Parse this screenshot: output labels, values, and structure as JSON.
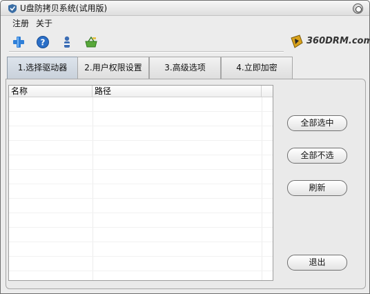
{
  "window": {
    "title": "U盘防拷贝系统(试用版)"
  },
  "menu": {
    "items": [
      "注册",
      "关于"
    ]
  },
  "toolbar": {
    "icons": [
      "add-icon",
      "help-icon",
      "user-icon",
      "basket-icon"
    ]
  },
  "logo": {
    "text": "360DRM.com"
  },
  "tabs": [
    "1.选择驱动器",
    "2.用户权限设置",
    "3.高级选项",
    "4.立即加密"
  ],
  "list": {
    "columns": [
      "名称",
      "路径",
      ""
    ]
  },
  "buttons": {
    "select_all": "全部选中",
    "select_none": "全部不选",
    "refresh": "刷新",
    "exit": "退出"
  }
}
